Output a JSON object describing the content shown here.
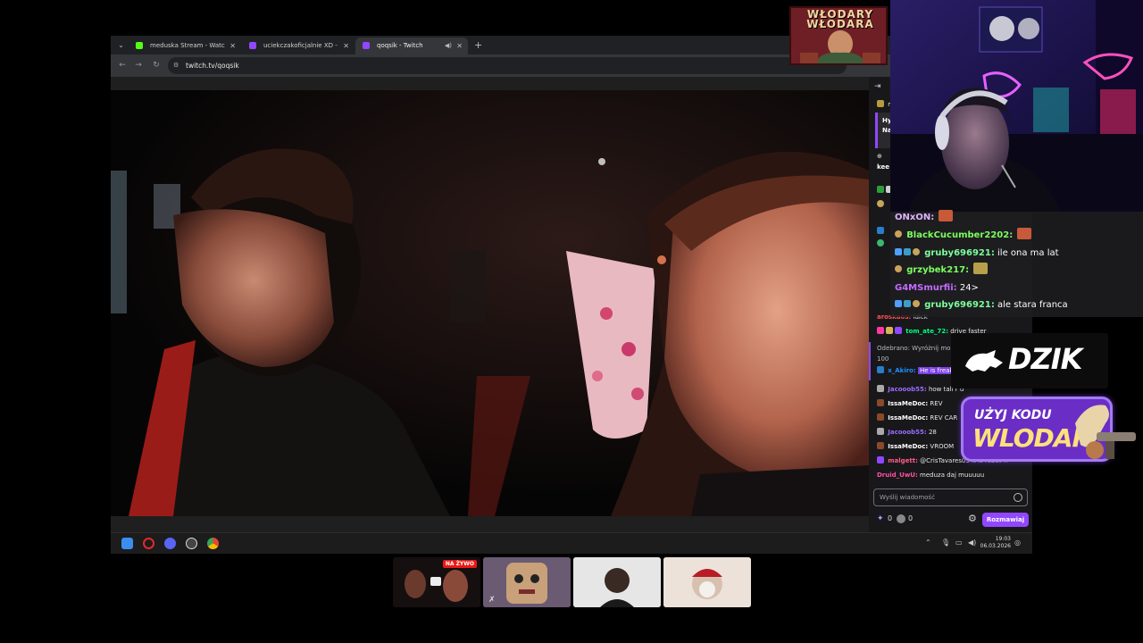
{
  "browser": {
    "tabs": [
      {
        "title": "meduska Stream - Watch Live o",
        "favicon_color": "#53fc18",
        "active": false
      },
      {
        "title": "uciekczakoficjalnie XD - Twitch",
        "favicon_color": "#9147ff",
        "active": false
      },
      {
        "title": "qoqsik - Twitch",
        "favicon_color": "#9147ff",
        "active": true
      }
    ],
    "url": "twitch.tv/qoqsik"
  },
  "chat_panel": {
    "header_fragment": "m",
    "pinned_lines": [
      "Hy",
      "Na"
    ],
    "pinned_sub": "kee",
    "messages": [
      {
        "user": "aroskaos:",
        "text": "ldick",
        "color": "#ff4f4f"
      },
      {
        "user": "tom_ate_72:",
        "text": "drive faster",
        "color": "#00ff7f"
      },
      {
        "user": "Odebrano: Wyróżnij mo",
        "text": "",
        "color": "#bbbbbb"
      },
      {
        "user": "100",
        "text": "",
        "color": "#bbbbbb"
      },
      {
        "user": "x_Akiro:",
        "text": "He is freak",
        "color": "#1e90ff"
      },
      {
        "user": "Jacooob55:",
        "text": "how tall r u",
        "color": "#9c6cff"
      },
      {
        "user": "IssaMeDoc:",
        "text": "REV",
        "color": "#ffffff"
      },
      {
        "user": "IssaMeDoc:",
        "text": "REV CAR",
        "color": "#ffffff"
      },
      {
        "user": "Jacooob55:",
        "text": "28",
        "color": "#9c6cff"
      },
      {
        "user": "IssaMeDoc:",
        "text": "VROOM",
        "color": "#ffffff"
      },
      {
        "user": "malgett:",
        "text": "@CrisTavares03 it is robot !!",
        "color": "#ff5b8a"
      },
      {
        "user": "Druid_UwU:",
        "text": "meduza daj muuuuu",
        "color": "#ff4fa0"
      }
    ],
    "input_placeholder": "Wyślij wiadomość",
    "points": "0",
    "bits": "0",
    "send_button": "Rozmawiaj"
  },
  "taskbar": {
    "time": "19:03",
    "date": "06.03.2026"
  },
  "logo": {
    "line1": "WŁODARY",
    "line2": "WŁODARA"
  },
  "overlay_chat": [
    {
      "user": "ONxON:",
      "text": "",
      "color": "#e0b3ff"
    },
    {
      "user": "BlackCucumber2202:",
      "text": "",
      "color": "#7cff5c"
    },
    {
      "user": "gruby696921:",
      "text": "ile ona ma lat",
      "color": "#7cff9c"
    },
    {
      "user": "grzybek217:",
      "text": "",
      "color": "#7cff5c"
    },
    {
      "user": "G4MSmurfii:",
      "text": "24>",
      "color": "#c56bff"
    },
    {
      "user": "gruby696921:",
      "text": "ale stara franca",
      "color": "#7cff9c"
    }
  ],
  "sponsor": {
    "brand": "DZIK",
    "promo_line1": "UŻYJ KODU",
    "promo_line2": "WLODAR"
  },
  "thumbnails": {
    "live_label": "NA ŻYWO"
  }
}
